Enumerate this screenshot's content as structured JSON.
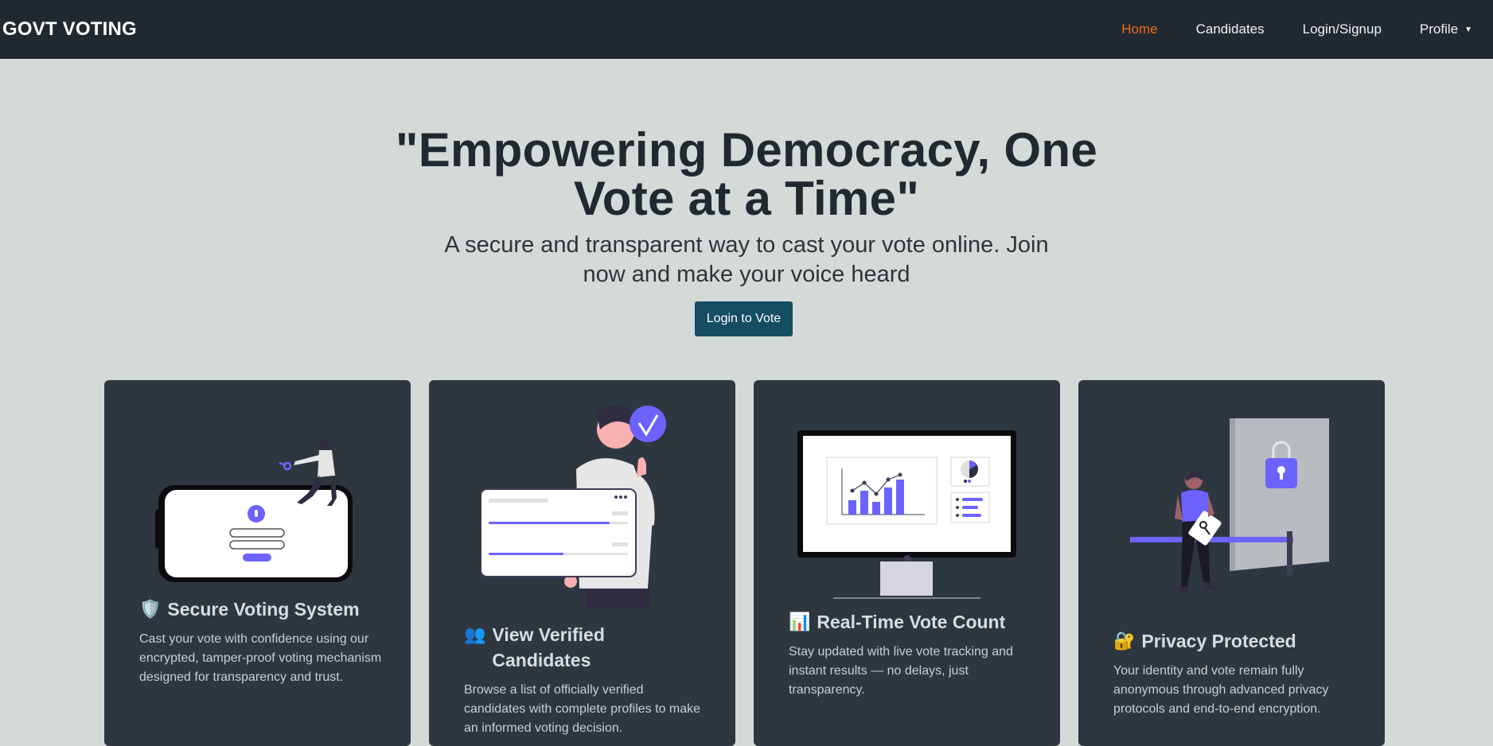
{
  "nav": {
    "brand": "GOVT VOTING",
    "links": [
      {
        "label": "Home",
        "active": true
      },
      {
        "label": "Candidates"
      },
      {
        "label": "Login/Signup"
      },
      {
        "label": "Profile"
      }
    ],
    "profile_caret": "▼"
  },
  "hero": {
    "title": "\"Empowering Democracy, One Vote at a Time\"",
    "subtitle": "A secure and transparent way to cast your vote online. Join now and make your voice heard",
    "cta_label": "Login to Vote"
  },
  "cards": [
    {
      "icon": "🛡️",
      "icon_name": "shield-icon",
      "title": "Secure Voting System",
      "text": "Cast your vote with confidence using our encrypted, tamper-proof voting mechanism designed for transparency and trust."
    },
    {
      "icon": "👥",
      "icon_name": "people-icon",
      "title": "View Verified Candidates",
      "text": "Browse a list of officially verified candidates with complete profiles to make an informed voting decision."
    },
    {
      "icon": "📊",
      "icon_name": "bar-chart-icon",
      "title": "Real-Time Vote Count",
      "text": "Stay updated with live vote tracking and instant results — no delays, just transparency."
    },
    {
      "icon": "🔐",
      "icon_name": "lock-key-icon",
      "title": "Privacy Protected",
      "text": "Your identity and vote remain fully anonymous through advanced privacy protocols and end-to-end encryption."
    }
  ],
  "colors": {
    "navbar": "#212930",
    "page_bg": "#d4dad7",
    "active_link": "#f26b1d",
    "cta": "#154d62",
    "card_bg": "#2e3740",
    "accent_purple": "#6c63ff"
  }
}
